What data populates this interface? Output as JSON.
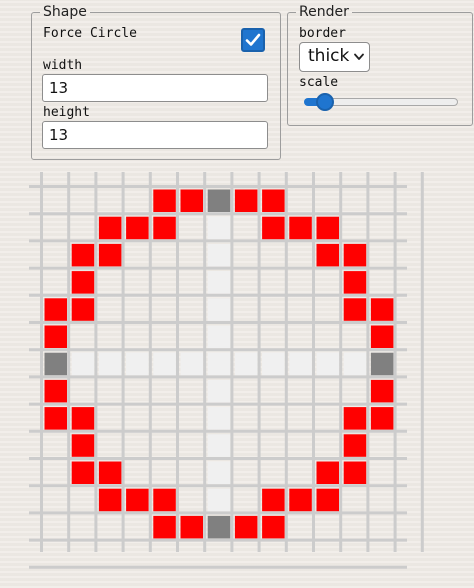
{
  "shape": {
    "legend": "Shape",
    "force_circle_label": "Force Circle",
    "force_circle_checked": true,
    "width_label": "width",
    "width_value": "13",
    "height_label": "height",
    "height_value": "13"
  },
  "render": {
    "legend": "Render",
    "border_label": "border",
    "border_value": "thick",
    "scale_label": "scale",
    "scale_fraction": 0.05
  },
  "grid": {
    "size": 13,
    "colors": {
      "filled": "#ff0000",
      "axis_end": "#808080",
      "axis_light": "#f0f0f0",
      "grid_line": "#cccccc"
    },
    "rows": [
      "....RR#RR....",
      "..RRR.|.RRR..",
      ".RR...|...RR.",
      ".R....|....R.",
      "RR....|....RR",
      "R.....|.....R",
      "#-----+-----#",
      "R.....|.....R",
      "RR....|....RR",
      ".R....|....R.",
      ".RR...|...RR.",
      "..RRR.|.RRR..",
      "....RR#RR...."
    ]
  }
}
